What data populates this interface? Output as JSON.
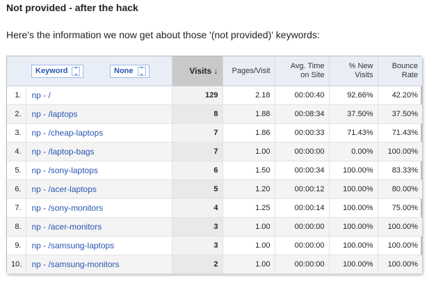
{
  "title": "Not provided - after the hack",
  "intro": "Here's the information we now get about those '(not provided)' keywords:",
  "table": {
    "primary_dimension": "Keyword",
    "secondary_dimension": "None",
    "columns": {
      "visits": "Visits ↓",
      "pages_visit": "Pages/Visit",
      "avg_time_1": "Avg. Time",
      "avg_time_2": "on Site",
      "pct_new_1": "% New",
      "pct_new_2": "Visits",
      "bounce_1": "Bounce",
      "bounce_2": "Rate"
    },
    "rows": [
      {
        "n": "1.",
        "kw": "np - /",
        "visits": "129",
        "pv": "2.18",
        "time": "00:00:40",
        "new": "92.66%",
        "bounce": "42.20%"
      },
      {
        "n": "2.",
        "kw": "np - /laptops",
        "visits": "8",
        "pv": "1.88",
        "time": "00:08:34",
        "new": "37.50%",
        "bounce": "37.50%"
      },
      {
        "n": "3.",
        "kw": "np - /cheap-laptops",
        "visits": "7",
        "pv": "1.86",
        "time": "00:00:33",
        "new": "71.43%",
        "bounce": "71.43%"
      },
      {
        "n": "4.",
        "kw": "np - /laptop-bags",
        "visits": "7",
        "pv": "1.00",
        "time": "00:00:00",
        "new": "0.00%",
        "bounce": "100.00%"
      },
      {
        "n": "5.",
        "kw": "np - /sony-laptops",
        "visits": "6",
        "pv": "1.50",
        "time": "00:00:34",
        "new": "100.00%",
        "bounce": "83.33%"
      },
      {
        "n": "6.",
        "kw": "np - /acer-laptops",
        "visits": "5",
        "pv": "1.20",
        "time": "00:00:12",
        "new": "100.00%",
        "bounce": "80.00%"
      },
      {
        "n": "7.",
        "kw": "np - /sony-monitors",
        "visits": "4",
        "pv": "1.25",
        "time": "00:00:14",
        "new": "100.00%",
        "bounce": "75.00%"
      },
      {
        "n": "8.",
        "kw": "np - /acer-monitors",
        "visits": "3",
        "pv": "1.00",
        "time": "00:00:00",
        "new": "100.00%",
        "bounce": "100.00%"
      },
      {
        "n": "9.",
        "kw": "np - /samsung-laptops",
        "visits": "3",
        "pv": "1.00",
        "time": "00:00:00",
        "new": "100.00%",
        "bounce": "100.00%"
      },
      {
        "n": "10.",
        "kw": "np - /samsung-monitors",
        "visits": "2",
        "pv": "1.00",
        "time": "00:00:00",
        "new": "100.00%",
        "bounce": "100.00%"
      }
    ]
  },
  "colors": {
    "link": "#2a55b2",
    "header_bg": "#e9eef6",
    "sorted_header_bg": "#c9c9c9"
  },
  "icons": {
    "dropdown": "chevron-updown-icon",
    "sort": "sort-descending-arrow"
  }
}
